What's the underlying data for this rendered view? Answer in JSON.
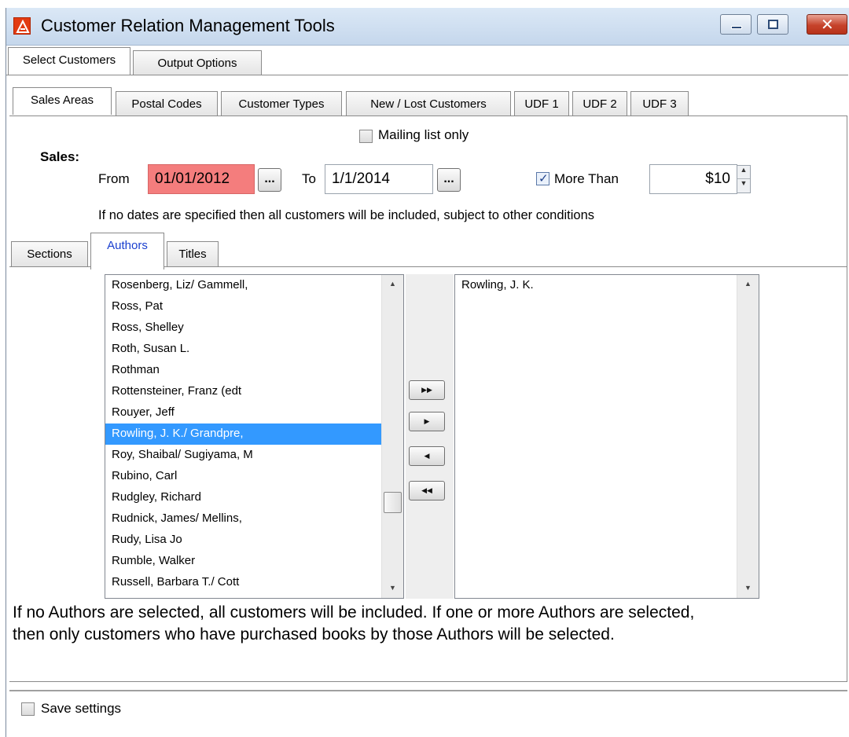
{
  "window": {
    "title": "Customer Relation Management Tools",
    "close_glyph": "✕"
  },
  "top_tabs": [
    "Select Customers",
    "Output Options"
  ],
  "sub_tabs": [
    "Sales Areas",
    "Postal Codes",
    "Customer Types",
    "New / Lost Customers",
    "UDF 1",
    "UDF 2",
    "UDF 3"
  ],
  "sales": {
    "mailing_list_label": "Mailing list only",
    "mailing_list_checked": false,
    "section_label": "Sales:",
    "from_label": "From",
    "from_value": "01/01/2012",
    "from_button": "...",
    "to_label": "To",
    "to_value": "1/1/2014",
    "to_button": "...",
    "more_than_label": "More Than",
    "more_than_checked": true,
    "amount_value": "$10",
    "note": "If no dates are specified then all customers will be included, subject to other conditions"
  },
  "inner_tabs": [
    "Sections",
    "Authors",
    "Titles"
  ],
  "authors": {
    "available": [
      "Rosenberg, Liz/ Gammell,",
      "Ross, Pat",
      "Ross, Shelley",
      "Roth, Susan L.",
      "Rothman",
      "Rottensteiner, Franz (edt",
      "Rouyer, Jeff",
      "Rowling, J. K./ Grandpre,",
      "Roy, Shaibal/ Sugiyama, M",
      "Rubino, Carl",
      "Rudgley, Richard",
      "Rudnick, James/ Mellins,",
      "Rudy, Lisa Jo",
      "Rumble, Walker",
      "Russell, Barbara T./ Cott"
    ],
    "selected_index": 7,
    "chosen": [
      "Rowling, J. K."
    ],
    "note_line1": "If no Authors are selected, all customers will be included. If one or more Authors are selected,",
    "note_line2": "then only customers who have purchased books by those Authors will be selected."
  },
  "save_settings": {
    "label": "Save settings",
    "checked": false
  },
  "colors": {
    "selection": "#3399ff",
    "invalid_field": "#f47d7d",
    "active_tab_text": "#1a3fcf"
  },
  "icons": {
    "app": "app-logo-icon",
    "minimize": "minimize-icon",
    "maximize": "maximize-icon",
    "close": "close-icon",
    "move_all_right": "double-right-arrow-icon",
    "move_right": "right-arrow-icon",
    "move_left": "left-arrow-icon",
    "move_all_left": "double-left-arrow-icon"
  }
}
